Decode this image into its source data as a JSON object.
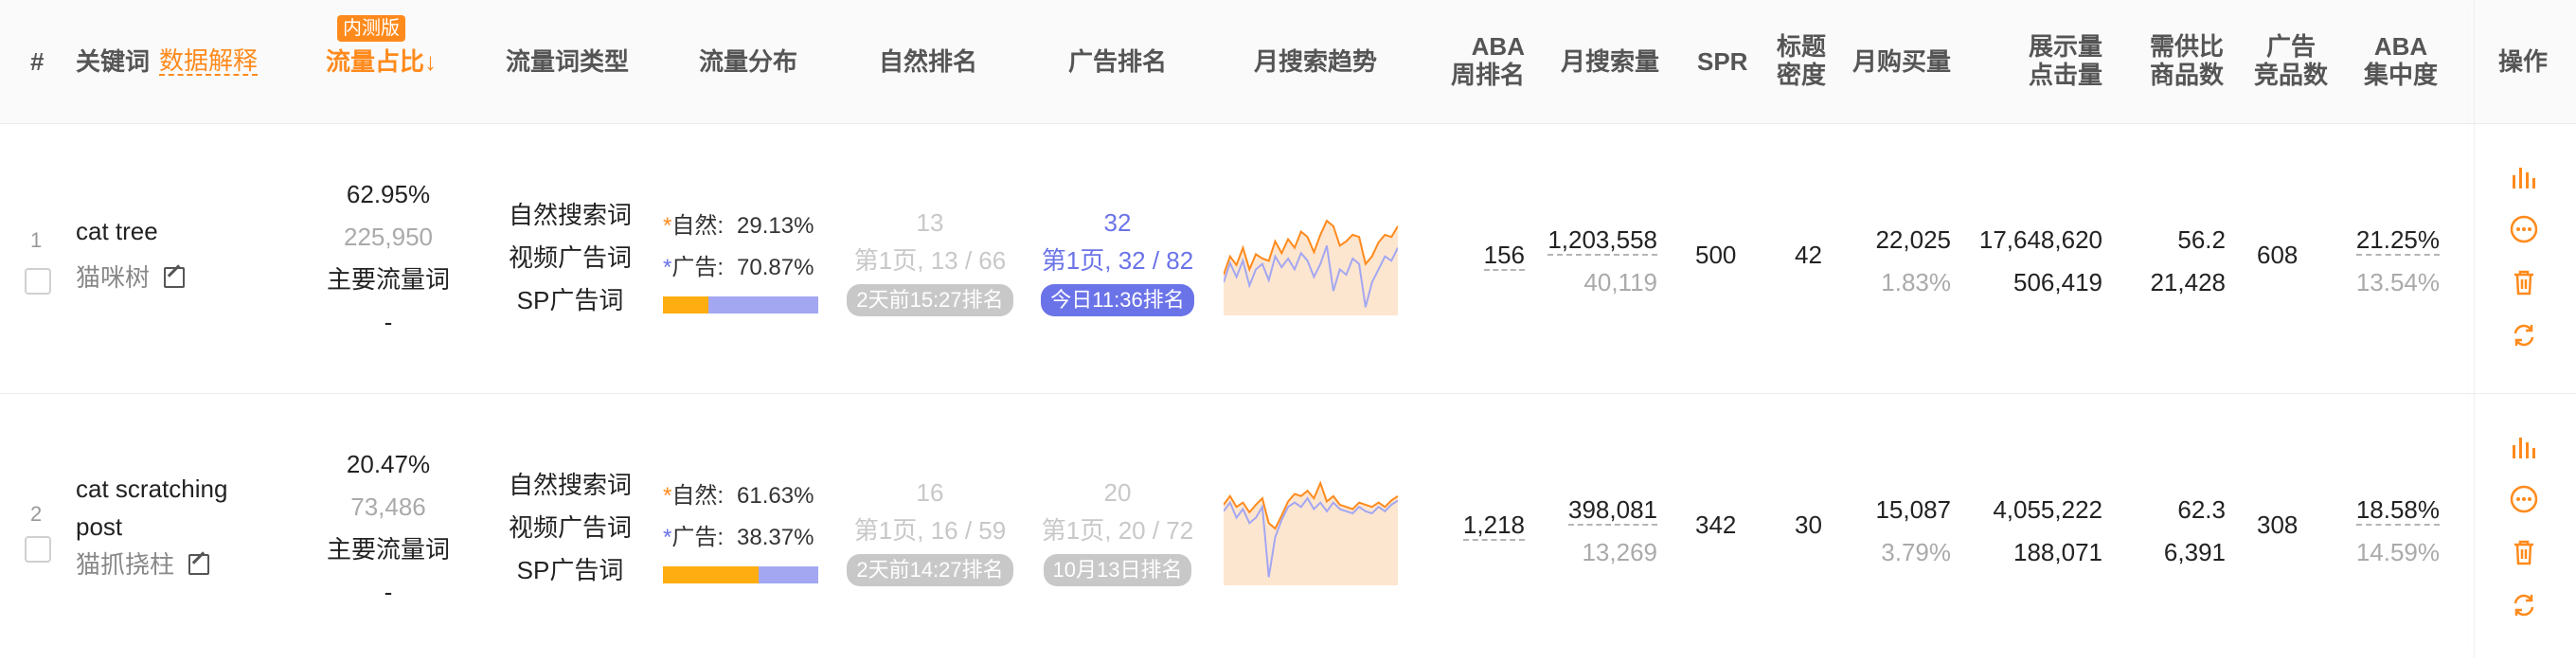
{
  "header": {
    "index": "#",
    "keyword": "关键词",
    "data_explain": "数据解释",
    "beta_badge": "内测版",
    "traffic_share": "流量占比↓",
    "keyword_type": "流量词类型",
    "traffic_dist": "流量分布",
    "organic_rank": "自然排名",
    "ad_rank": "广告排名",
    "monthly_trend": "月搜索趋势",
    "aba_weekly_1": "ABA",
    "aba_weekly_2": "周排名",
    "monthly_search": "月搜索量",
    "spr": "SPR",
    "title_density_1": "标题",
    "title_density_2": "密度",
    "monthly_purchase": "月购买量",
    "impr_click_1": "展示量",
    "impr_click_2": "点击量",
    "supply_demand_1": "需供比",
    "supply_demand_2": "商品数",
    "ad_competitors_1": "广告",
    "ad_competitors_2": "竞品数",
    "aba_conc_1": "ABA",
    "aba_conc_2": "集中度",
    "actions": "操作"
  },
  "colors": {
    "orange": "#ff8a1c",
    "purple": "#6b73e8",
    "ad_bar": "#a3a7f2",
    "trend_fill": "#fde6d0"
  },
  "rows": [
    {
      "index": "1",
      "keyword": "cat tree",
      "translation": "猫咪树",
      "traffic_pct": "62.95%",
      "traffic_count": "225,950",
      "traffic_role": "主要流量词",
      "traffic_extra": "-",
      "types": [
        "自然搜索词",
        "视频广告词",
        "SP广告词"
      ],
      "dist_natural_label": "自然:",
      "dist_natural": "29.13%",
      "dist_natural_frac": 0.2913,
      "dist_ad_label": "广告:",
      "dist_ad": "70.87%",
      "organic_top": "13",
      "organic_page": "第1页, 13 / 66",
      "organic_badge": "2天前15:27排名",
      "ad_top": "32",
      "ad_page": "第1页, 32 / 82",
      "ad_badge": "今日11:36排名",
      "ad_active": true,
      "trend_orange": [
        0.35,
        0.52,
        0.44,
        0.6,
        0.4,
        0.54,
        0.5,
        0.48,
        0.66,
        0.55,
        0.68,
        0.6,
        0.75,
        0.7,
        0.56,
        0.72,
        0.85,
        0.8,
        0.62,
        0.66,
        0.72,
        0.7,
        0.45,
        0.52,
        0.65,
        0.72,
        0.7,
        0.8
      ],
      "trend_purple": [
        0.28,
        0.46,
        0.33,
        0.48,
        0.25,
        0.4,
        0.45,
        0.3,
        0.52,
        0.42,
        0.5,
        0.4,
        0.55,
        0.48,
        0.33,
        0.45,
        0.62,
        0.2,
        0.4,
        0.35,
        0.5,
        0.45,
        0.05,
        0.28,
        0.4,
        0.52,
        0.48,
        0.6
      ],
      "aba_weekly": "156",
      "monthly_search": "1,203,558",
      "monthly_search_sub": "40,119",
      "spr": "500",
      "title_density": "42",
      "monthly_purchase": "22,025",
      "purchase_rate": "1.83%",
      "impressions": "17,648,620",
      "clicks": "506,419",
      "supply_demand": "56.2",
      "product_count": "21,428",
      "ad_competitors": "608",
      "aba_conc": "21.25%",
      "aba_conc_sub": "13.54%"
    },
    {
      "index": "2",
      "keyword_line1": "cat scratching",
      "keyword_line2": "post",
      "translation": "猫抓挠柱",
      "traffic_pct": "20.47%",
      "traffic_count": "73,486",
      "traffic_role": "主要流量词",
      "traffic_extra": "-",
      "types": [
        "自然搜索词",
        "视频广告词",
        "SP广告词"
      ],
      "dist_natural_label": "自然:",
      "dist_natural": "61.63%",
      "dist_natural_frac": 0.6163,
      "dist_ad_label": "广告:",
      "dist_ad": "38.37%",
      "organic_top": "16",
      "organic_page": "第1页, 16 / 59",
      "organic_badge": "2天前14:27排名",
      "ad_top": "20",
      "ad_page": "第1页, 20 / 72",
      "ad_badge": "10月13日排名",
      "ad_active": false,
      "trend_orange": [
        0.72,
        0.8,
        0.7,
        0.74,
        0.65,
        0.72,
        0.78,
        0.55,
        0.5,
        0.62,
        0.75,
        0.82,
        0.8,
        0.85,
        0.78,
        0.92,
        0.75,
        0.8,
        0.72,
        0.7,
        0.68,
        0.74,
        0.72,
        0.7,
        0.74,
        0.7,
        0.76,
        0.8
      ],
      "trend_purple": [
        0.66,
        0.74,
        0.6,
        0.68,
        0.55,
        0.6,
        0.7,
        0.05,
        0.42,
        0.58,
        0.7,
        0.74,
        0.7,
        0.78,
        0.68,
        0.74,
        0.66,
        0.74,
        0.68,
        0.66,
        0.64,
        0.7,
        0.66,
        0.64,
        0.7,
        0.66,
        0.72,
        0.76
      ],
      "aba_weekly": "1,218",
      "monthly_search": "398,081",
      "monthly_search_sub": "13,269",
      "spr": "342",
      "title_density": "30",
      "monthly_purchase": "15,087",
      "purchase_rate": "3.79%",
      "impressions": "4,055,222",
      "clicks": "188,071",
      "supply_demand": "62.3",
      "product_count": "6,391",
      "ad_competitors": "308",
      "aba_conc": "18.58%",
      "aba_conc_sub": "14.59%"
    }
  ]
}
